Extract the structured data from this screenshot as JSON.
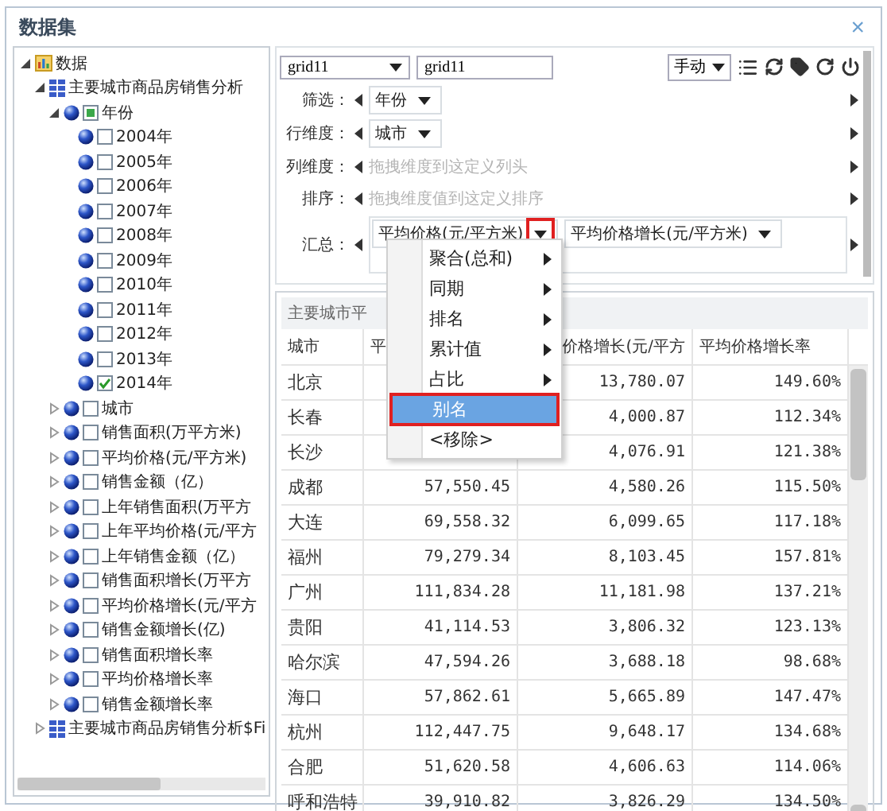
{
  "dialog": {
    "title": "数据集",
    "close": "×"
  },
  "tree": [
    {
      "label": "数据",
      "kind": "root",
      "expanded": true,
      "children": [
        {
          "label": "主要城市商品房销售分析",
          "kind": "table",
          "expanded": true,
          "children": [
            {
              "label": "年份",
              "kind": "field",
              "expanded": true,
              "checked": false,
              "partial": true,
              "children": [
                {
                  "label": "2004年",
                  "kind": "field",
                  "checked": false
                },
                {
                  "label": "2005年",
                  "kind": "field",
                  "checked": false
                },
                {
                  "label": "2006年",
                  "kind": "field",
                  "checked": false
                },
                {
                  "label": "2007年",
                  "kind": "field",
                  "checked": false
                },
                {
                  "label": "2008年",
                  "kind": "field",
                  "checked": false
                },
                {
                  "label": "2009年",
                  "kind": "field",
                  "checked": false
                },
                {
                  "label": "2010年",
                  "kind": "field",
                  "checked": false
                },
                {
                  "label": "2011年",
                  "kind": "field",
                  "checked": false
                },
                {
                  "label": "2012年",
                  "kind": "field",
                  "checked": false
                },
                {
                  "label": "2013年",
                  "kind": "field",
                  "checked": false
                },
                {
                  "label": "2014年",
                  "kind": "field",
                  "checked": true
                }
              ]
            },
            {
              "label": "城市",
              "kind": "field",
              "expanded": false,
              "checked": false
            },
            {
              "label": "销售面积(万平方米)",
              "kind": "field",
              "expanded": false,
              "checked": false
            },
            {
              "label": "平均价格(元/平方米)",
              "kind": "field",
              "expanded": false,
              "checked": false
            },
            {
              "label": "销售金额（亿）",
              "kind": "field",
              "expanded": false,
              "checked": false
            },
            {
              "label": "上年销售面积(万平方",
              "kind": "field",
              "expanded": false,
              "checked": false
            },
            {
              "label": "上年平均价格(元/平方",
              "kind": "field",
              "expanded": false,
              "checked": false
            },
            {
              "label": "上年销售金额（亿）",
              "kind": "field",
              "expanded": false,
              "checked": false
            },
            {
              "label": "销售面积增长(万平方",
              "kind": "field",
              "expanded": false,
              "checked": false
            },
            {
              "label": "平均价格增长(元/平方",
              "kind": "field",
              "expanded": false,
              "checked": false
            },
            {
              "label": "销售金额增长(亿)",
              "kind": "field",
              "expanded": false,
              "checked": false
            },
            {
              "label": "销售面积增长率",
              "kind": "field",
              "expanded": false,
              "checked": false
            },
            {
              "label": "平均价格增长率",
              "kind": "field",
              "expanded": false,
              "checked": false
            },
            {
              "label": "销售金额增长率",
              "kind": "field",
              "expanded": false,
              "checked": false
            }
          ]
        },
        {
          "label": "主要城市商品房销售分析$Fi",
          "kind": "table",
          "expanded": false
        }
      ]
    }
  ],
  "toolbar": {
    "grid_select": "grid11",
    "grid_name": "grid11",
    "mode": "手动"
  },
  "config_rows": [
    {
      "label": "筛选：",
      "kind": "items",
      "items": [
        {
          "label": "年份",
          "highlighted": false
        }
      ]
    },
    {
      "label": "行维度：",
      "kind": "items",
      "items": [
        {
          "label": "城市",
          "highlighted": false
        }
      ]
    },
    {
      "label": "列维度：",
      "kind": "placeholder",
      "placeholder": "拖拽维度到这定义列头"
    },
    {
      "label": "排序：",
      "kind": "placeholder",
      "placeholder": "拖拽维度值到这定义排序"
    },
    {
      "label": "汇总：",
      "kind": "summary",
      "items": [
        {
          "label": "平均价格(元/平方米)",
          "highlighted": true
        },
        {
          "label": "平均价格增长(元/平方米)",
          "highlighted": false
        }
      ]
    }
  ],
  "context_menu": [
    {
      "label": "聚合(总和)",
      "submenu": true,
      "selected": false
    },
    {
      "label": "同期",
      "submenu": true,
      "selected": false
    },
    {
      "label": "排名",
      "submenu": true,
      "selected": false
    },
    {
      "label": "累计值",
      "submenu": true,
      "selected": false
    },
    {
      "label": "占比",
      "submenu": true,
      "selected": false
    },
    {
      "label": "别名",
      "submenu": false,
      "selected": true
    },
    {
      "label": "<移除>",
      "submenu": false,
      "selected": false
    }
  ],
  "table": {
    "title": "主要城市平",
    "columns": [
      "城市",
      "平",
      "价格增长(元/平方",
      "平均价格增长率"
    ],
    "rows": [
      {
        "city": "北京",
        "growth": "13,780.07",
        "rate": "149.60%"
      },
      {
        "city": "长春",
        "growth": "4,000.87",
        "rate": "112.34%"
      },
      {
        "city": "长沙",
        "growth": "4,076.91",
        "rate": "121.38%"
      },
      {
        "city": "成都",
        "price": "57,550.45",
        "growth": "4,580.26",
        "rate": "115.50%"
      },
      {
        "city": "大连",
        "price": "69,558.32",
        "growth": "6,099.65",
        "rate": "117.18%"
      },
      {
        "city": "福州",
        "price": "79,279.34",
        "growth": "8,103.45",
        "rate": "157.81%"
      },
      {
        "city": "广州",
        "price": "111,834.28",
        "growth": "11,181.98",
        "rate": "137.21%"
      },
      {
        "city": "贵阳",
        "price": "41,114.53",
        "growth": "3,806.32",
        "rate": "123.13%"
      },
      {
        "city": "哈尔滨",
        "price": "47,594.26",
        "growth": "3,688.18",
        "rate": "98.68%"
      },
      {
        "city": "海口",
        "price": "57,862.61",
        "growth": "5,665.89",
        "rate": "147.47%"
      },
      {
        "city": "杭州",
        "price": "112,447.75",
        "growth": "9,648.17",
        "rate": "134.68%"
      },
      {
        "city": "合肥",
        "price": "51,620.58",
        "growth": "4,606.63",
        "rate": "114.06%"
      },
      {
        "city": "呼和浩特",
        "price": "39,910.82",
        "growth": "3,826.29",
        "rate": "134.50%"
      }
    ]
  }
}
